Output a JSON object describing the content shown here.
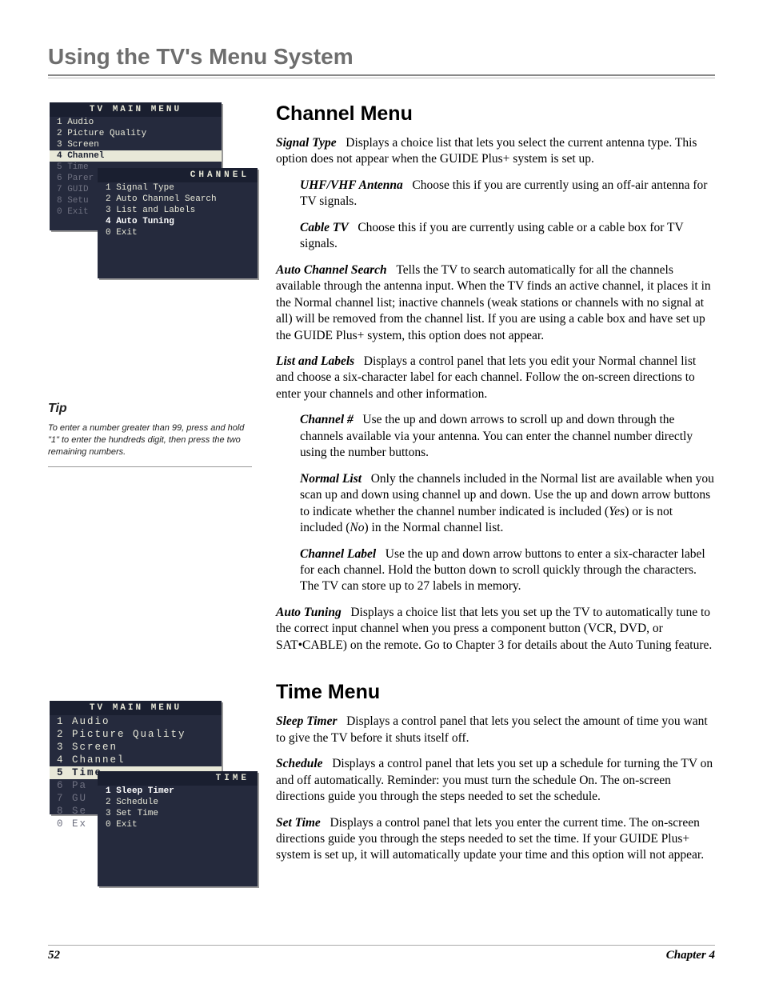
{
  "page_title": "Using the TV's Menu System",
  "footer": {
    "page": "52",
    "chapter": "Chapter 4"
  },
  "osd1": {
    "header": "TV MAIN MENU",
    "rows": [
      {
        "text": "1 Audio",
        "cls": ""
      },
      {
        "text": "2 Picture Quality",
        "cls": ""
      },
      {
        "text": "3 Screen",
        "cls": ""
      },
      {
        "text": "4 Channel",
        "cls": "sel"
      },
      {
        "text": "5 Time",
        "cls": "dim"
      },
      {
        "text": "6 Parer",
        "cls": "dim"
      },
      {
        "text": "7 GUID",
        "cls": "dim"
      },
      {
        "text": "8 Setu",
        "cls": "dim"
      },
      {
        "text": "0 Exit",
        "cls": "dim"
      }
    ],
    "sub_header": "CHANNEL",
    "sub_rows": [
      {
        "text": "1 Signal Type",
        "cls": ""
      },
      {
        "text": "2 Auto Channel Search",
        "cls": ""
      },
      {
        "text": "3 List and Labels",
        "cls": ""
      },
      {
        "text": "4 Auto Tuning",
        "cls": "cursor"
      },
      {
        "text": "0 Exit",
        "cls": ""
      }
    ]
  },
  "osd2": {
    "header": "TV MAIN MENU",
    "rows": [
      {
        "text": "1 Audio",
        "cls": ""
      },
      {
        "text": "2 Picture Quality",
        "cls": ""
      },
      {
        "text": "3 Screen",
        "cls": ""
      },
      {
        "text": "4 Channel",
        "cls": ""
      },
      {
        "text": "5 Time",
        "cls": "sel"
      },
      {
        "text": "6 Pa",
        "cls": "dim"
      },
      {
        "text": "7 GU",
        "cls": "dim"
      },
      {
        "text": "8 Se",
        "cls": "dim"
      },
      {
        "text": "0 Ex",
        "cls": "dim"
      }
    ],
    "sub_header": "TIME",
    "sub_rows": [
      {
        "text": "1 Sleep Timer",
        "cls": "cursor"
      },
      {
        "text": "2 Schedule",
        "cls": ""
      },
      {
        "text": "3 Set Time",
        "cls": ""
      },
      {
        "text": "0 Exit",
        "cls": ""
      }
    ]
  },
  "tip": {
    "heading": "Tip",
    "body": "To enter a number greater than 99, press and hold \"1\" to enter the hundreds digit, then press the two remaining numbers."
  },
  "channel_menu": {
    "heading": "Channel Menu",
    "signal_type_term": "Signal Type",
    "signal_type_body": "Displays a choice list that lets you select the current antenna type. This option does not appear when the GUIDE Plus+ system is set up.",
    "uhf_term": "UHF/VHF Antenna",
    "uhf_body": "Choose this if you are currently using an off-air antenna for TV signals.",
    "cable_term": "Cable TV",
    "cable_body": "Choose this if you are currently using cable or a cable box for TV signals.",
    "auto_search_term": "Auto Channel Search",
    "auto_search_body": "Tells the TV to search automatically for all the channels available through the antenna input. When the TV finds an active channel, it places it in the Normal channel list; inactive channels (weak stations or channels with no signal at all) will be removed from the channel list. If you are using a cable box and have set up the GUIDE Plus+ system, this option does not appear.",
    "list_labels_term": "List and Labels",
    "list_labels_body": "Displays a control panel that lets you edit your Normal channel list and choose a six-character label for each channel. Follow the on-screen directions to enter your channels and other information.",
    "channel_num_term": "Channel #",
    "channel_num_body": "Use the up and down arrows to scroll up and down through the channels available via your antenna. You can enter the channel number directly using the number buttons.",
    "normal_list_term": "Normal List",
    "normal_list_body_1": "Only the channels included in the Normal list are available when you scan up and down using channel up and down. Use the up and down arrow buttons to indicate whether the channel number indicated is included (",
    "normal_list_yes": "Yes",
    "normal_list_body_2": ") or is not included (",
    "normal_list_no": "No",
    "normal_list_body_3": ") in the Normal channel list.",
    "channel_label_term": "Channel Label",
    "channel_label_body": "Use the up and down arrow buttons to enter a six-character label for each channel. Hold the button down to scroll quickly through the characters. The TV can store up to 27 labels in memory.",
    "auto_tuning_term": "Auto Tuning",
    "auto_tuning_body": "Displays a choice list that lets you set up the TV to automatically tune to the correct input channel when you press a component button (VCR, DVD, or SAT•CABLE) on the remote. Go to Chapter 3 for details about the Auto Tuning feature."
  },
  "time_menu": {
    "heading": "Time Menu",
    "sleep_term": "Sleep Timer",
    "sleep_body": "Displays a control panel that lets you select the amount of time you want to give the TV before it shuts itself off.",
    "schedule_term": "Schedule",
    "schedule_body": "Displays a control panel that lets you set up a schedule for turning the TV on and off automatically. Reminder: you must turn the schedule On. The on-screen directions guide you through the steps needed to set the schedule.",
    "set_time_term": "Set Time",
    "set_time_body": "Displays a control panel that lets you enter the current time. The on-screen directions guide you through the steps needed to set the time. If your GUIDE Plus+ system is set up, it will automatically update your time and this option will not appear."
  }
}
